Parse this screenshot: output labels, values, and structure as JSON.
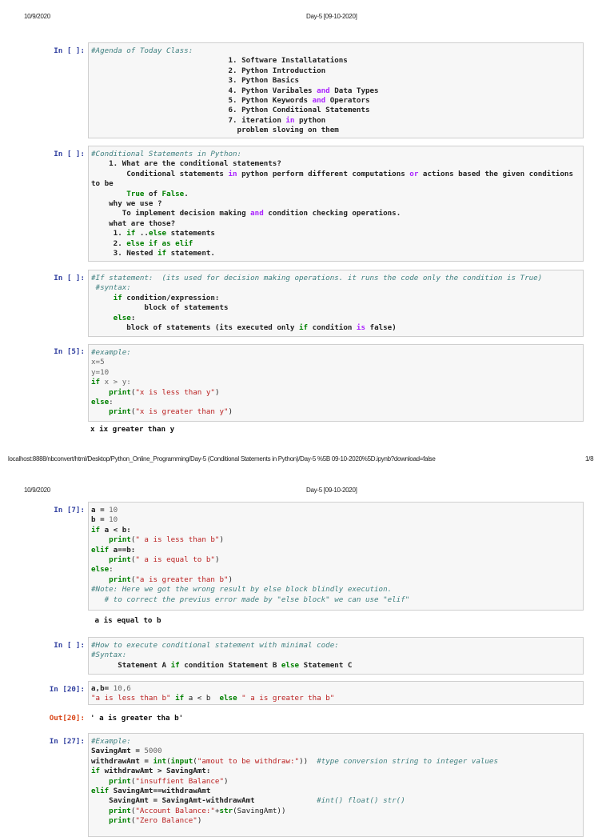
{
  "page1": {
    "date": "10/9/2020",
    "title": "Day-5 [09-10-2020]",
    "footer_url": "localhost:8888/nbconvert/html/Desktop/Python_Online_Programming/Day-5 (Conditional Statements in Python)/Day-5 %5B 09-10-2020%5D.ipynb?download=false",
    "page_number": "1/8"
  },
  "page2": {
    "date": "10/9/2020",
    "title": "Day-5 [09-10-2020]"
  },
  "cells": [
    {
      "prompt": "In [ ]:",
      "lines": [
        [
          [
            "#Agenda of Today Class:",
            "c"
          ]
        ],
        [
          [
            "                               1. Software Installatations",
            "b"
          ]
        ],
        [
          [
            "                               2. Python Introduction",
            "b"
          ]
        ],
        [
          [
            "                               3. Python Basics",
            "b"
          ]
        ],
        [
          [
            "                               4. Python Varibales ",
            "b"
          ],
          [
            "and",
            "p"
          ],
          [
            " Data Types",
            "b"
          ]
        ],
        [
          [
            "                               5. Python Keywords ",
            "b"
          ],
          [
            "and",
            "p"
          ],
          [
            " Operators",
            "b"
          ]
        ],
        [
          [
            "                               6. Python Conditional Statements",
            "b"
          ]
        ],
        [
          [
            "                               7. iteration ",
            "b"
          ],
          [
            "in",
            "p"
          ],
          [
            " python",
            "b"
          ]
        ],
        [
          [
            "                                 problem sloving on them",
            "b"
          ]
        ]
      ]
    },
    {
      "prompt": "In [ ]:",
      "lines": [
        [
          [
            "#Conditional Statements in Python:",
            "c"
          ]
        ],
        [
          [
            "    1. What are the conditional statements?",
            "b"
          ]
        ],
        [
          [
            "        Conditional statements ",
            "b"
          ],
          [
            "in",
            "p"
          ],
          [
            " python perform different computations ",
            "b"
          ],
          [
            "or",
            "p"
          ],
          [
            " actions based the given conditions",
            "b"
          ]
        ],
        [
          [
            "to be",
            "b"
          ]
        ],
        [
          [
            "        ",
            "b"
          ],
          [
            "True",
            "k"
          ],
          [
            " of ",
            "b"
          ],
          [
            "False",
            "k"
          ],
          [
            ".",
            "b"
          ]
        ],
        [
          [
            "    why we use ?",
            "b"
          ]
        ],
        [
          [
            "       To implement decision making ",
            "b"
          ],
          [
            "and",
            "p"
          ],
          [
            " condition checking operations.",
            "b"
          ]
        ],
        [
          [
            "    what are those?",
            "b"
          ]
        ],
        [
          [
            "     1. ",
            "b"
          ],
          [
            "if",
            "k"
          ],
          [
            " ..",
            "b"
          ],
          [
            "else",
            "k"
          ],
          [
            " statements",
            "b"
          ]
        ],
        [
          [
            "     2. ",
            "b"
          ],
          [
            "else if",
            "k"
          ],
          [
            " ",
            "b"
          ],
          [
            "as",
            "k"
          ],
          [
            " ",
            "b"
          ],
          [
            "elif",
            "k"
          ]
        ],
        [
          [
            "     3. Nested ",
            "b"
          ],
          [
            "if",
            "k"
          ],
          [
            " statement.",
            "b"
          ]
        ]
      ]
    },
    {
      "prompt": "In [ ]:",
      "lines": [
        [
          [
            "#If statement:  (its used for decision making operations. it runs the code only the condition is True)",
            "c"
          ]
        ],
        [
          [
            " #syntax:",
            "c"
          ]
        ],
        [
          [
            "     ",
            "b"
          ],
          [
            "if",
            "k"
          ],
          [
            " condition/expression:",
            "b"
          ]
        ],
        [
          [
            "            block of statements",
            "b"
          ]
        ],
        [
          [
            "     ",
            "b"
          ],
          [
            "else",
            "k"
          ],
          [
            ":",
            "b"
          ]
        ],
        [
          [
            "        block of statements (its executed only ",
            "b"
          ],
          [
            "if",
            "k"
          ],
          [
            " condition ",
            "b"
          ],
          [
            "is",
            "p"
          ],
          [
            " false)",
            "b"
          ]
        ]
      ]
    },
    {
      "prompt": "In [5]:",
      "lines": [
        [
          [
            "#example:",
            "c"
          ]
        ],
        [
          [
            "x=5",
            "g"
          ]
        ],
        [
          [
            "y=10",
            "g"
          ]
        ],
        [
          [
            "if",
            "k"
          ],
          [
            " x > y:",
            "g"
          ]
        ],
        [
          [
            "    ",
            "n"
          ],
          [
            "print",
            "k"
          ],
          [
            "(",
            "n"
          ],
          [
            "\"x is less than y\"",
            "s"
          ],
          [
            ")",
            "n"
          ]
        ],
        [
          [
            "else",
            "k"
          ],
          [
            ":",
            "n"
          ]
        ],
        [
          [
            "    ",
            "n"
          ],
          [
            "print",
            "k"
          ],
          [
            "(",
            "n"
          ],
          [
            "\"x is greater than y\"",
            "s"
          ],
          [
            ")",
            "n"
          ]
        ]
      ],
      "output": "x ix greater than y"
    },
    {
      "prompt": "In [7]:",
      "lines": [
        [
          [
            "a = ",
            "b"
          ],
          [
            "10",
            "g"
          ]
        ],
        [
          [
            "b = ",
            "b"
          ],
          [
            "10",
            "g"
          ]
        ],
        [
          [
            "if",
            "k"
          ],
          [
            " a < b:",
            "b"
          ]
        ],
        [
          [
            "    ",
            "n"
          ],
          [
            "print",
            "k"
          ],
          [
            "(",
            "n"
          ],
          [
            "\" a is less than b\"",
            "s"
          ],
          [
            ")",
            "n"
          ]
        ],
        [
          [
            "elif",
            "k"
          ],
          [
            " a==b:",
            "b"
          ]
        ],
        [
          [
            "    ",
            "n"
          ],
          [
            "print",
            "k"
          ],
          [
            "(",
            "n"
          ],
          [
            "\" a is equal to b\"",
            "s"
          ],
          [
            ")",
            "n"
          ]
        ],
        [
          [
            "else",
            "k"
          ],
          [
            ":",
            "n"
          ]
        ],
        [
          [
            "    ",
            "n"
          ],
          [
            "print",
            "k"
          ],
          [
            "(",
            "n"
          ],
          [
            "\"a is greater than b\"",
            "s"
          ],
          [
            ")",
            "n"
          ]
        ],
        [
          [
            "#Note: Here we got the wrong result by else block blindly execution.",
            "c"
          ]
        ],
        [
          [
            "   # to correct the previus error made by \"else block\" we can use \"elif\"",
            "c"
          ]
        ]
      ],
      "output": " a is equal to b"
    },
    {
      "prompt": "In [ ]:",
      "lines": [
        [
          [
            "#How to execute conditional statement with minimal code:",
            "c"
          ]
        ],
        [
          [
            "#Syntax:",
            "c"
          ]
        ],
        [
          [
            "      Statement A ",
            "b"
          ],
          [
            "if",
            "k"
          ],
          [
            " condition Statement B ",
            "b"
          ],
          [
            "else",
            "k"
          ],
          [
            " Statement C",
            "b"
          ]
        ]
      ]
    },
    {
      "prompt": "In [20]:",
      "lines": [
        [
          [
            "a,b= ",
            "b"
          ],
          [
            "10,6",
            "g"
          ]
        ],
        [
          [
            "\"a is less than b\"",
            "s"
          ],
          [
            " ",
            "n"
          ],
          [
            "if",
            "k"
          ],
          [
            " a < b  ",
            "n"
          ],
          [
            "else",
            "k"
          ],
          [
            " ",
            "n"
          ],
          [
            "\" a is greater tha b\"",
            "s"
          ]
        ]
      ],
      "out_prompt": "Out[20]:",
      "output": "' a is greater tha b'"
    },
    {
      "prompt": "In [27]:",
      "lines": [
        [
          [
            "#Example:",
            "c"
          ]
        ],
        [
          [
            "SavingAmt = ",
            "b"
          ],
          [
            "5000",
            "g"
          ]
        ],
        [
          [
            "withdrawAmt = ",
            "b"
          ],
          [
            "int",
            "k"
          ],
          [
            "(",
            "n"
          ],
          [
            "input",
            "k"
          ],
          [
            "(",
            "n"
          ],
          [
            "\"amout to be withdraw:\"",
            "s"
          ],
          [
            "))  ",
            "n"
          ],
          [
            "#type conversion string to integer values",
            "c"
          ]
        ],
        [
          [
            "if",
            "k"
          ],
          [
            " withdrawAmt > SavingAmt:",
            "b"
          ]
        ],
        [
          [
            "    ",
            "n"
          ],
          [
            "print",
            "k"
          ],
          [
            "(",
            "n"
          ],
          [
            "\"insuffient Balance\"",
            "s"
          ],
          [
            ")",
            "n"
          ]
        ],
        [
          [
            "elif",
            "k"
          ],
          [
            " SavingAmt==withdrawAmt",
            "b"
          ]
        ],
        [
          [
            "    SavingAmt = SavingAmt-withdrawAmt              ",
            "b"
          ],
          [
            "#int() float() str()",
            "c"
          ]
        ],
        [
          [
            "    ",
            "n"
          ],
          [
            "print",
            "k"
          ],
          [
            "(",
            "n"
          ],
          [
            "\"Account Balance:\"",
            "s"
          ],
          [
            "+",
            "n"
          ],
          [
            "str",
            "k"
          ],
          [
            "(SavingAmt))",
            "n"
          ]
        ],
        [
          [
            "    ",
            "n"
          ],
          [
            "print",
            "k"
          ],
          [
            "(",
            "n"
          ],
          [
            "\"Zero Balance\"",
            "s"
          ],
          [
            ")",
            "n"
          ]
        ]
      ]
    }
  ]
}
